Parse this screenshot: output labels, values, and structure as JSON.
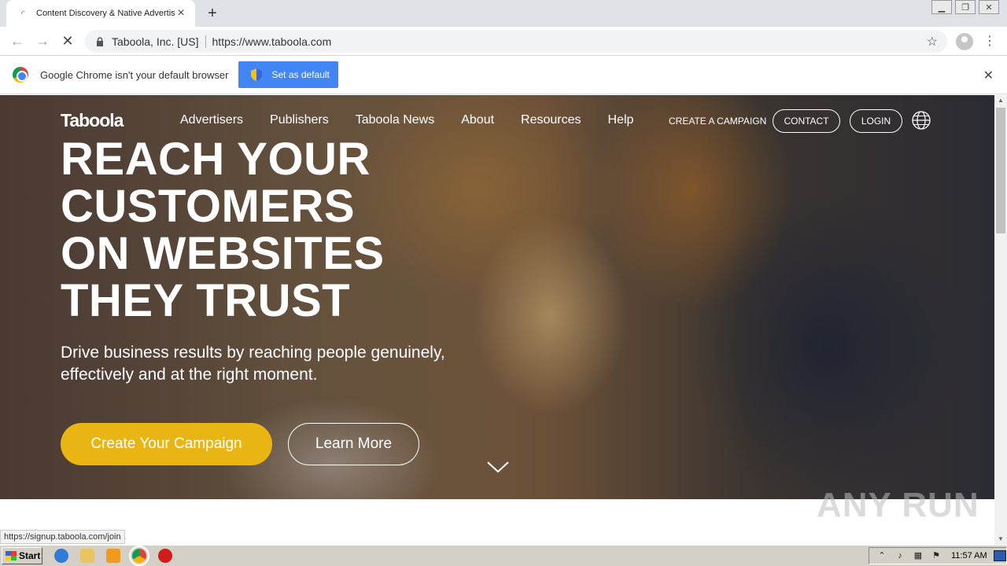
{
  "browser": {
    "tab_title": "Content Discovery & Native Advertis",
    "new_tab": "+",
    "org": "Taboola, Inc. [US]",
    "url": "https://www.taboola.com",
    "infobar_text": "Google Chrome isn't your default browser",
    "set_default_label": "Set as default",
    "status_url": "https://signup.taboola.com/join"
  },
  "site": {
    "logo": "Taboola",
    "nav": [
      "Advertisers",
      "Publishers",
      "Taboola News",
      "About",
      "Resources",
      "Help"
    ],
    "create_campaign_link": "CREATE A CAMPAIGN",
    "contact_label": "CONTACT",
    "login_label": "LOGIN",
    "headline": [
      "REACH YOUR",
      "CUSTOMERS",
      "ON WEBSITES",
      "THEY TRUST"
    ],
    "subheadline": "Drive business results by reaching people genuinely, effectively and at the right moment.",
    "primary_cta": "Create Your Campaign",
    "secondary_cta": "Learn More",
    "watermark": "ANY RUN"
  },
  "taskbar": {
    "start_label": "Start",
    "clock": "11:57 AM"
  },
  "colors": {
    "primary_cta": "#e9b512",
    "chrome_blue": "#4285f4"
  }
}
